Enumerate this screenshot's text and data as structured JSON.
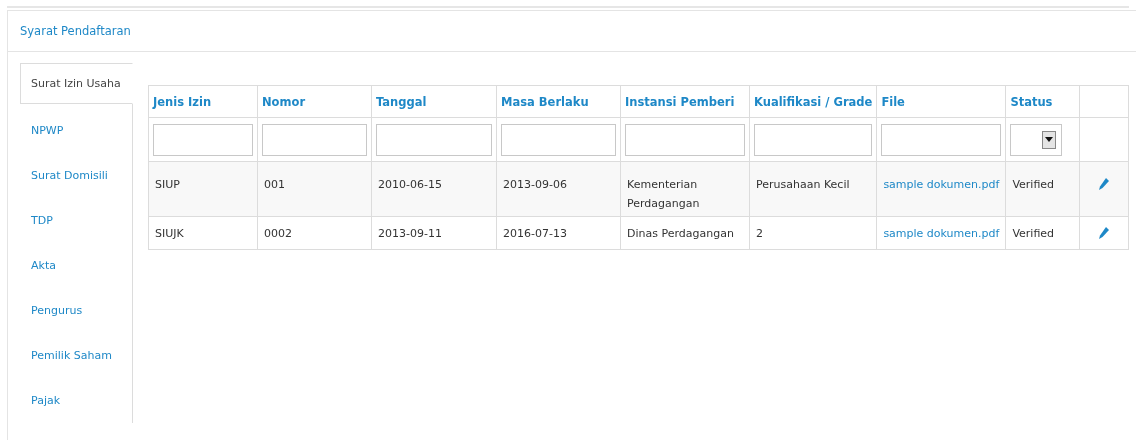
{
  "panel": {
    "title": "Syarat Pendaftaran"
  },
  "tabs": [
    {
      "label": "Surat Izin Usaha",
      "selected": true
    },
    {
      "label": "NPWP",
      "selected": false
    },
    {
      "label": "Surat Domisili",
      "selected": false
    },
    {
      "label": "TDP",
      "selected": false
    },
    {
      "label": "Akta",
      "selected": false
    },
    {
      "label": "Pengurus",
      "selected": false
    },
    {
      "label": "Pemilik Saham",
      "selected": false
    },
    {
      "label": "Pajak",
      "selected": false
    }
  ],
  "table": {
    "columns": [
      "Jenis Izin",
      "Nomor",
      "Tanggal",
      "Masa Berlaku",
      "Instansi Pemberi",
      "Kualifikasi / Grade",
      "File",
      "Status"
    ],
    "filters": [
      {
        "kind": "text"
      },
      {
        "kind": "text"
      },
      {
        "kind": "text"
      },
      {
        "kind": "text"
      },
      {
        "kind": "text"
      },
      {
        "kind": "text"
      },
      {
        "kind": "text"
      },
      {
        "kind": "select"
      }
    ],
    "rows": [
      {
        "cells": [
          "SIUP",
          "001",
          "2010-06-15",
          "2013-09-06",
          "Kementerian Perdagangan",
          "Perusahaan Kecil"
        ],
        "file": "sample dokumen.pdf",
        "status": "Verified"
      },
      {
        "cells": [
          "SIUJK",
          "0002",
          "2013-09-11",
          "2016-07-13",
          "Dinas Perdagangan",
          "2"
        ],
        "file": "sample dokumen.pdf",
        "status": "Verified"
      }
    ]
  }
}
